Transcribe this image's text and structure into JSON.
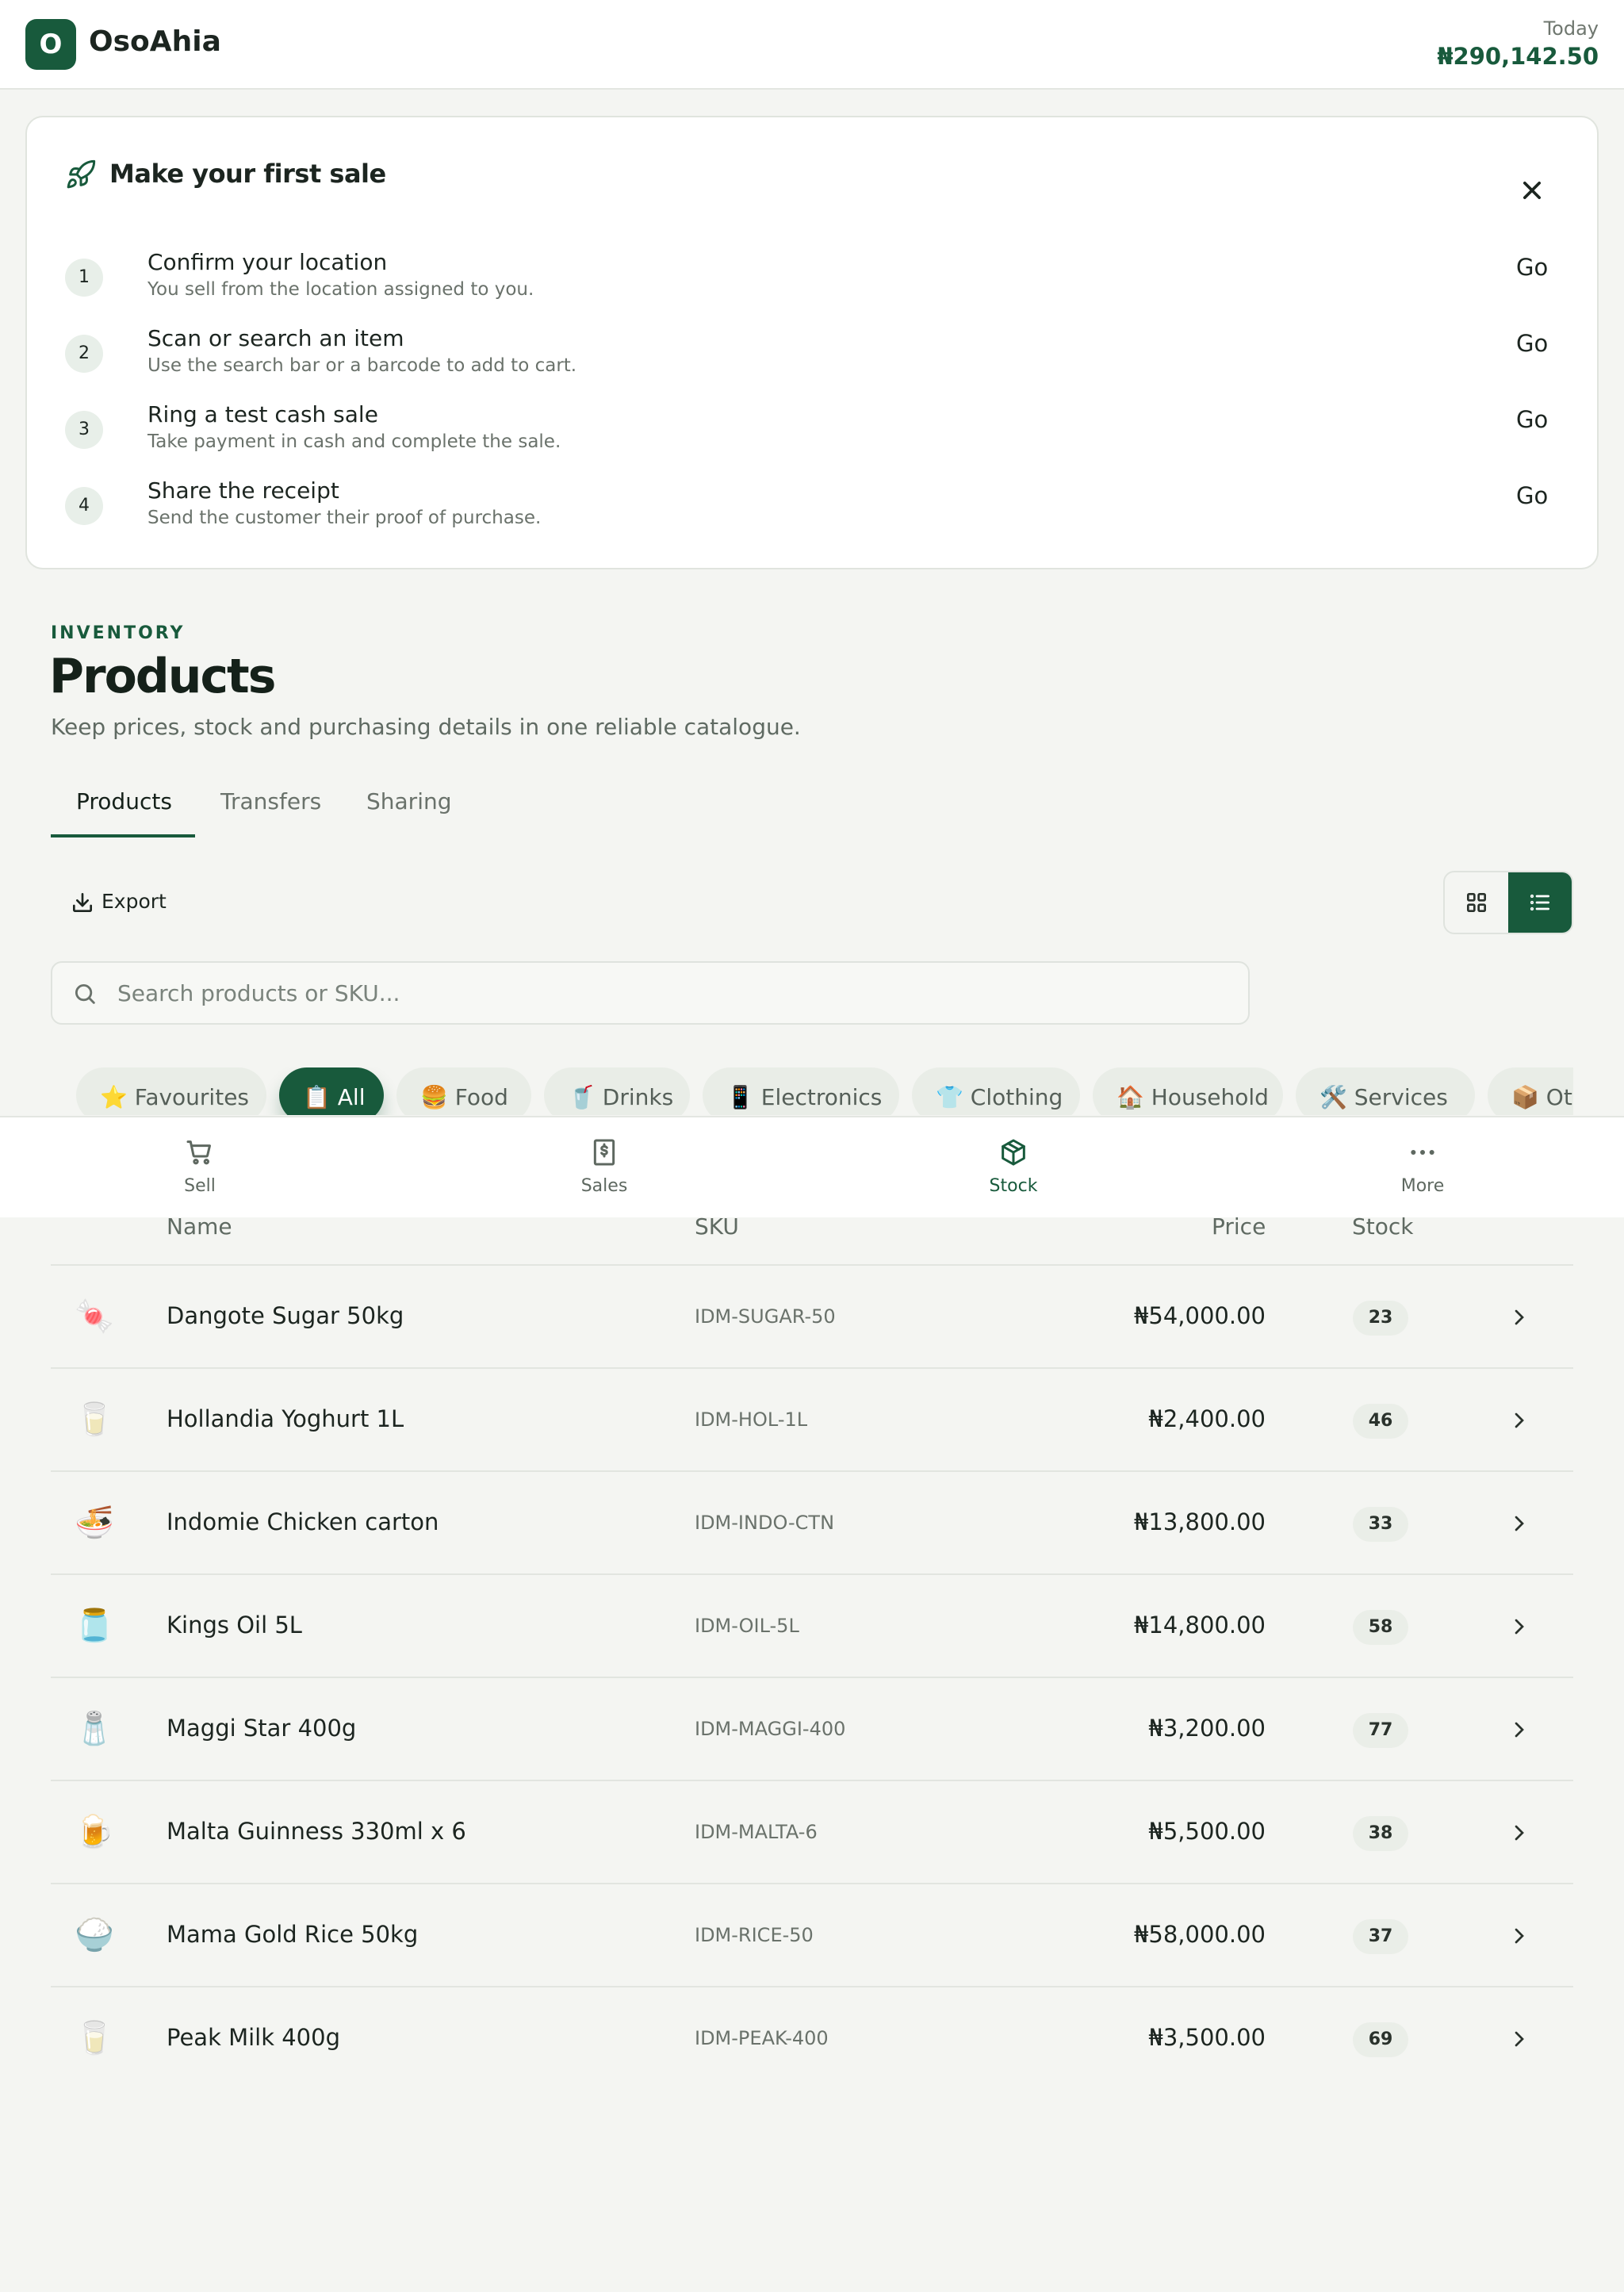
{
  "app": {
    "brand_initial": "O",
    "brand_name": "OsoAhia"
  },
  "header": {
    "today_label": "Today",
    "today_amount": "₦290,142.50"
  },
  "onboarding": {
    "title": "Make your first sale",
    "steps": [
      {
        "num": "1",
        "title": "Confirm your location",
        "desc": "You sell from the location assigned to you.",
        "action": "Go"
      },
      {
        "num": "2",
        "title": "Scan or search an item",
        "desc": "Use the search bar or a barcode to add to cart.",
        "action": "Go"
      },
      {
        "num": "3",
        "title": "Ring a test cash sale",
        "desc": "Take payment in cash and complete the sale.",
        "action": "Go"
      },
      {
        "num": "4",
        "title": "Share the receipt",
        "desc": "Send the customer their proof of purchase.",
        "action": "Go"
      }
    ]
  },
  "page": {
    "eyebrow": "INVENTORY",
    "title": "Products",
    "subtitle": "Keep prices, stock and purchasing details in one reliable catalogue."
  },
  "tabs": [
    "Products",
    "Transfers",
    "Sharing"
  ],
  "toolbar": {
    "export_label": "Export"
  },
  "search": {
    "placeholder": "Search products or SKU..."
  },
  "categories": [
    {
      "emoji": "⭐",
      "label": "Favourites"
    },
    {
      "emoji": "📋",
      "label": "All"
    },
    {
      "emoji": "🍔",
      "label": "Food"
    },
    {
      "emoji": "🥤",
      "label": "Drinks"
    },
    {
      "emoji": "📱",
      "label": "Electronics"
    },
    {
      "emoji": "👕",
      "label": "Clothing"
    },
    {
      "emoji": "🏠",
      "label": "Household"
    },
    {
      "emoji": "🛠️",
      "label": "Services"
    },
    {
      "emoji": "📦",
      "label": "Oth"
    }
  ],
  "bottom_nav": [
    {
      "label": "Sell",
      "icon": "cart-icon"
    },
    {
      "label": "Sales",
      "icon": "receipt-icon"
    },
    {
      "label": "Stock",
      "icon": "box-icon"
    },
    {
      "label": "More",
      "icon": "more-icon"
    }
  ],
  "table": {
    "columns": [
      "Name",
      "SKU",
      "Price",
      "Stock"
    ],
    "rows": [
      {
        "emoji": "🍬",
        "name": "Dangote Sugar 50kg",
        "sku": "IDM-SUGAR-50",
        "price": "₦54,000.00",
        "stock": "23"
      },
      {
        "emoji": "🥛",
        "name": "Hollandia Yoghurt 1L",
        "sku": "IDM-HOL-1L",
        "price": "₦2,400.00",
        "stock": "46"
      },
      {
        "emoji": "🍜",
        "name": "Indomie Chicken carton",
        "sku": "IDM-INDO-CTN",
        "price": "₦13,800.00",
        "stock": "33"
      },
      {
        "emoji": "🫙",
        "name": "Kings Oil 5L",
        "sku": "IDM-OIL-5L",
        "price": "₦14,800.00",
        "stock": "58"
      },
      {
        "emoji": "🧂",
        "name": "Maggi Star 400g",
        "sku": "IDM-MAGGI-400",
        "price": "₦3,200.00",
        "stock": "77"
      },
      {
        "emoji": "🍺",
        "name": "Malta Guinness 330ml x 6",
        "sku": "IDM-MALTA-6",
        "price": "₦5,500.00",
        "stock": "38"
      },
      {
        "emoji": "🍚",
        "name": "Mama Gold Rice 50kg",
        "sku": "IDM-RICE-50",
        "price": "₦58,000.00",
        "stock": "37"
      },
      {
        "emoji": "🥛",
        "name": "Peak Milk 400g",
        "sku": "IDM-PEAK-400",
        "price": "₦3,500.00",
        "stock": "69"
      }
    ]
  },
  "colors": {
    "brand": "#185a3c",
    "background": "#f4f5f2",
    "surface": "#ffffff"
  }
}
